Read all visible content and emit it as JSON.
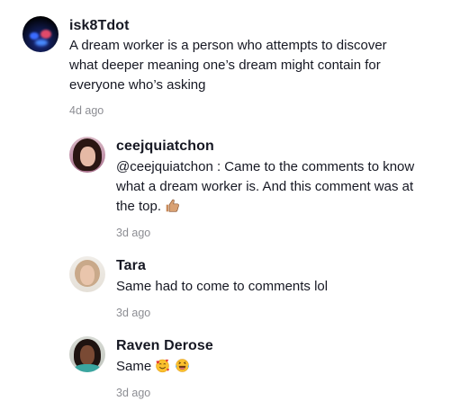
{
  "comments": [
    {
      "username": "isk8Tdot",
      "lines": [
        "A dream worker is a person who attempts to discover",
        "what deeper meaning one’s dream might contain for",
        "everyone who’s asking"
      ],
      "time": "4d ago"
    }
  ],
  "replies": [
    {
      "username": "ceejquiatchon",
      "lines": [
        "@ceejquiatchon :  Came to the comments to know",
        "what a dream worker is. And this comment was at",
        "the top."
      ],
      "emoji": "thumbs-up-icon",
      "time": "3d ago"
    },
    {
      "username": "Tara",
      "text": "Same had to come to comments lol",
      "time": "3d ago"
    },
    {
      "username": "Raven Derose",
      "text": "Same",
      "emojis": [
        "smiling-face-with-hearts-icon",
        "tears-of-joy-icon"
      ],
      "time": "3d ago"
    }
  ],
  "colors": {
    "text": "#161823",
    "muted": "rgba(22,24,35,0.5)",
    "background": "#ffffff"
  }
}
